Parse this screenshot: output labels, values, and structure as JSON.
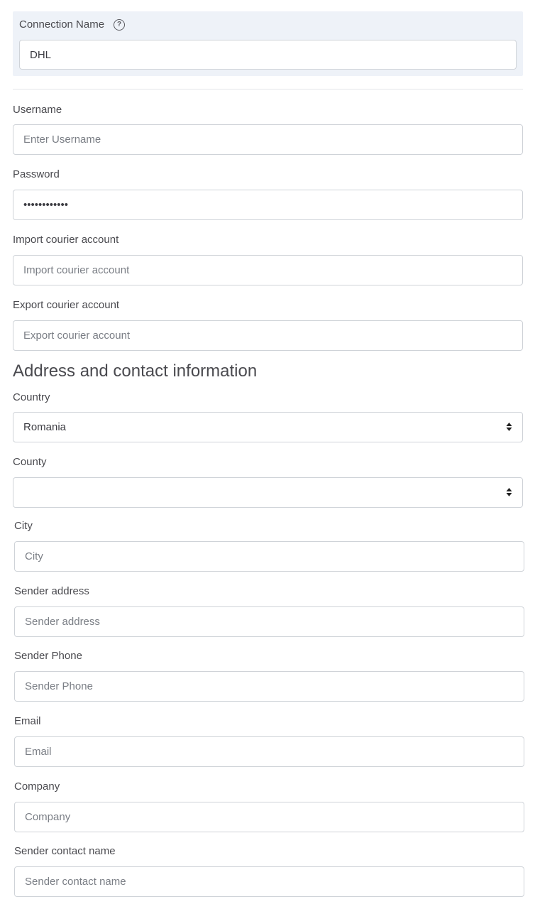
{
  "connection": {
    "label": "Connection Name",
    "value": "DHL",
    "help_icon": "question-circle-icon"
  },
  "fields": {
    "username": {
      "label": "Username",
      "placeholder": "Enter Username",
      "value": ""
    },
    "password": {
      "label": "Password",
      "value": "••••••••••••"
    },
    "import_account": {
      "label": "Import courier account",
      "placeholder": "Import courier account"
    },
    "export_account": {
      "label": "Export courier account",
      "placeholder": "Export courier account"
    }
  },
  "section": {
    "title": "Address and contact information"
  },
  "address": {
    "country": {
      "label": "Country",
      "selected": "Romania",
      "icon": "sort-arrows-icon"
    },
    "county": {
      "label": "County",
      "selected": "",
      "icon": "sort-arrows-icon"
    },
    "city": {
      "label": "City",
      "placeholder": "City"
    },
    "sender_address": {
      "label": "Sender address",
      "placeholder": "Sender address"
    },
    "sender_phone": {
      "label": "Sender Phone",
      "placeholder": "Sender Phone"
    },
    "email": {
      "label": "Email",
      "placeholder": "Email"
    },
    "company": {
      "label": "Company",
      "placeholder": "Company"
    },
    "sender_contact": {
      "label": "Sender contact name",
      "placeholder": "Sender contact name"
    }
  }
}
